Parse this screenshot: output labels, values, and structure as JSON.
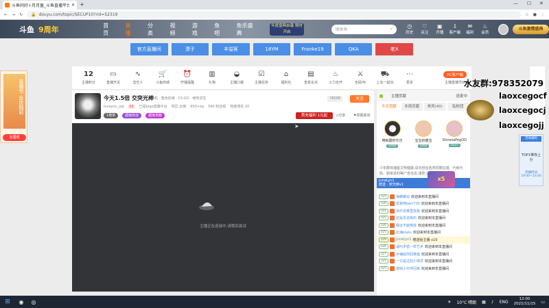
{
  "browser": {
    "tab_title": "斗鱼同好+月月童_斗鱼直播平台",
    "url": "douyu.com/topic/SECUP10?rid=52319"
  },
  "header": {
    "logo_text": "斗鱼",
    "logo_badge": "9周年",
    "nav": [
      "首页",
      "直播",
      "分类",
      "视频",
      "游戏",
      "鱼吧",
      "鱼乐盛典"
    ],
    "promo": "年度盛典启幕 限时开启",
    "search_placeholder": "搜索鱼",
    "icons": [
      {
        "label": "历史",
        "icon": "clock-icon"
      },
      {
        "label": "关注",
        "icon": "heart-icon"
      },
      {
        "label": "开播",
        "icon": "camera-icon"
      },
      {
        "label": "客户端",
        "icon": "download-icon"
      },
      {
        "label": "福利",
        "icon": "gift-icon"
      },
      {
        "label": "会员",
        "icon": "bulb-icon"
      }
    ],
    "brand_label": "斗鱼激情盛典"
  },
  "anchors": [
    "官方直播间",
    "漂子",
    "丰溢客",
    "18YM",
    "Franke19",
    "QKA",
    "老X"
  ],
  "toolbar": {
    "count": "12",
    "count_label": "主播积分",
    "items": [
      "直播开关",
      "音乐人",
      "斗鱼商城",
      "开播提醒",
      "礼物",
      "主播口袋",
      "主播任务",
      "福利社",
      "查看论点",
      "火力全开",
      "全民PK",
      "上车一起玩",
      "更多"
    ],
    "pc_label": "PC客户端",
    "pc_sub": "主播直播节目"
  },
  "room": {
    "title": "今天1.5倍 交突光棒",
    "tags": "单机 · 角色扮演 · CS:GO · 绝地求生",
    "anchor_name": "loveyou_jiaj",
    "level": "66",
    "line2_extra": [
      "已是bigo直播平台",
      "地区:云南",
      "993+kg",
      "580 粉丝组",
      "热度排名 20"
    ],
    "pills": [
      "1榜单",
      "超级粉丝",
      "超级贡献"
    ],
    "follow_count": "78008",
    "follow_label": "关注",
    "fan_btn": "首充福利 1元起",
    "share": "分享",
    "report": "举报房间"
  },
  "video": {
    "loading_text": "主播正在连接中,请稍后尝试"
  },
  "chat": {
    "header_label": "主播贡献",
    "header_right": "连麦中",
    "tabs": [
      "今日贡献",
      "本周贡献",
      "贵宾(40)",
      "贴粉团"
    ],
    "ranks": [
      {
        "name": "带就跟你乐乐",
        "level": "LV68"
      },
      {
        "name": "宝宝的暖宝",
        "level": "LV68"
      },
      {
        "name": "ShinelaPegOD",
        "level": "LV37"
      }
    ],
    "notice": "少年群体播客文明健康,请勿轻信各类招聘征婚、代练代购、刷单返利等广告信息,谨防上当受骗。",
    "user": "JuneLyn1",
    "user_sub": "赠送 · 荧光棒x1",
    "gift": "x5",
    "messages": [
      {
        "lv": "LV5",
        "user": "海螺螺站",
        "text": "欢迎来到本直播间"
      },
      {
        "lv": "LV8",
        "user": "爱我吧bert730",
        "text": "欢迎来到本直播间"
      },
      {
        "lv": "LV4",
        "user": "快乐去哪里找我",
        "text": "欢迎来到本直播间"
      },
      {
        "lv": "LV5",
        "user": "还是去追我的",
        "text": "欢迎来到本直播间"
      },
      {
        "lv": "LV6",
        "user": "我还不能够放",
        "text": "欢迎来到本直播间"
      },
      {
        "lv": "LV5",
        "user": "云海klaks",
        "text": "欢迎来到本直播间"
      },
      {
        "lv": "LV9",
        "user": "JuneLyn1",
        "text": "赠送给主播 x10"
      },
      {
        "lv": "LV6",
        "user": "请叫矛盾一样艺术",
        "text": "欢迎来到本直播间"
      },
      {
        "lv": "LV7",
        "user": "木铺给你回答面",
        "text": "欢迎来到本直播间"
      },
      {
        "lv": "LV5",
        "user": "一只是过的小绵羊",
        "text": "欢迎来到本直播间"
      },
      {
        "lv": "LV5",
        "user": "游戏小伙伴回来",
        "text": "欢迎来到本直播间"
      }
    ]
  },
  "left_ad": {
    "text": "直播节 全民精彩",
    "button": "去围观"
  },
  "overlay": {
    "qq": "水友群:978352079",
    "names": [
      "laoxcegocf",
      "laoxcegocj",
      "laoxcegojj"
    ]
  },
  "right_ad": {
    "top": "活动福利",
    "mid": "TOP1带你上分",
    "bottom": "开播时间 19:00~23:00"
  },
  "taskbar": {
    "weather": "10°C 晴朗",
    "lang": "ENG",
    "time": "12:00",
    "date": "2021/11/15"
  }
}
